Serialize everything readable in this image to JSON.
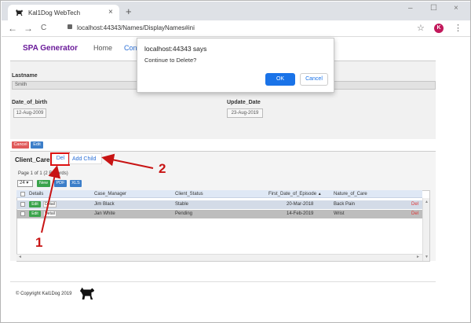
{
  "browser": {
    "tab_title": "Kal1Dog WebTech",
    "close_glyph": "×",
    "newtab_glyph": "+",
    "url": "localhost:44343/Names/DisplayNames#ini",
    "avatar_letter": "K",
    "window_controls": [
      "–",
      "☐",
      "×"
    ],
    "nav_glyphs": [
      "←",
      "→",
      "C"
    ],
    "star_glyph": "☆",
    "menu_glyph": "⋮"
  },
  "appnav": {
    "brand": "SPA Generator",
    "links": [
      "Home",
      "Cont"
    ]
  },
  "form": {
    "lastname_label": "Lastname",
    "lastname_value": "Smith",
    "dob_label": "Date_of_birth",
    "dob_value": "12-Aug-2009",
    "update_label": "Update_Date",
    "update_value": "23-Aug-2019",
    "cancel_label": "Cancel",
    "edit_label": "Edit"
  },
  "client_care": {
    "title": "Client_Care",
    "del_label": "Del",
    "add_child_label": "Add Child",
    "pager_text": "Page 1 of 1   (2 Records)",
    "page_size": "24",
    "new_label": "New",
    "pdf_label": "PDF",
    "xls_label": "XLS",
    "headers": [
      "Details",
      "Case_Manager",
      "Client_Status",
      "First_Date_of_Episode",
      "Nature_of_Care"
    ],
    "sort_glyph": "▲",
    "edit_label": "Edit",
    "detail_label": "Detail",
    "row_del_label": "Del",
    "rows": [
      {
        "case_manager": "Jim Black",
        "client_status": "Stable",
        "first_date": "20-Mar-2018",
        "nature_of_care": "Back Pain"
      },
      {
        "case_manager": "Jan White",
        "client_status": "Pending",
        "first_date": "14-Feb-2019",
        "nature_of_care": "Wrist"
      }
    ],
    "scroll_glyphs": [
      "▲",
      "▼",
      "◄",
      "►"
    ]
  },
  "footer": {
    "copyright": "© Copyright Kal1Dog 2019"
  },
  "dialog": {
    "title": "localhost:44343 says",
    "message": "Continue to Delete?",
    "ok_label": "OK",
    "cancel_label": "Cancel"
  },
  "annotations": {
    "one": "1",
    "two": "2"
  },
  "colors": {
    "annotation_red": "#c81414",
    "brand_purple": "#6a1b9a",
    "primary_blue": "#1a73e8",
    "new_green": "#3aa34a"
  }
}
